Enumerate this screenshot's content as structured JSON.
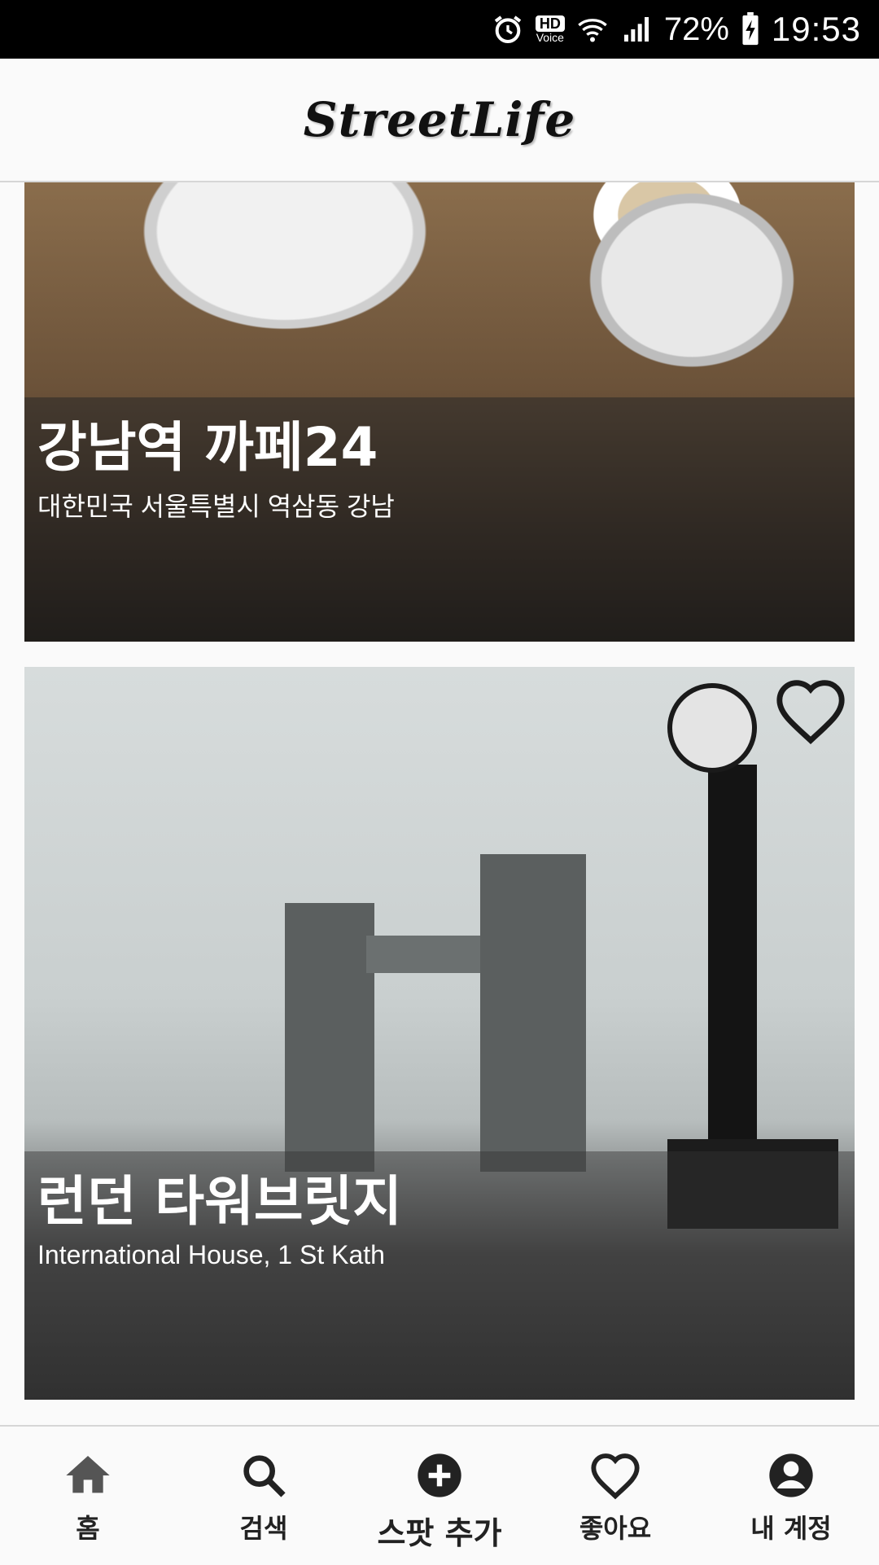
{
  "status_bar": {
    "hd_label": "HD",
    "voice_label": "Voice",
    "battery": "72%",
    "time": "19:53"
  },
  "app": {
    "title": "StreetLife"
  },
  "feed": [
    {
      "title": "강남역 까페24",
      "subtitle": "대한민국 서울특별시 역삼동 강남"
    },
    {
      "title": "런던 타워브릿지",
      "subtitle": "International House, 1 St Kath"
    }
  ],
  "nav": [
    {
      "label": "홈",
      "icon": "home-icon"
    },
    {
      "label": "검색",
      "icon": "search-icon"
    },
    {
      "label": "스팟 추가",
      "icon": "add-circle-icon"
    },
    {
      "label": "좋아요",
      "icon": "heart-icon"
    },
    {
      "label": "내 계정",
      "icon": "account-icon"
    }
  ]
}
